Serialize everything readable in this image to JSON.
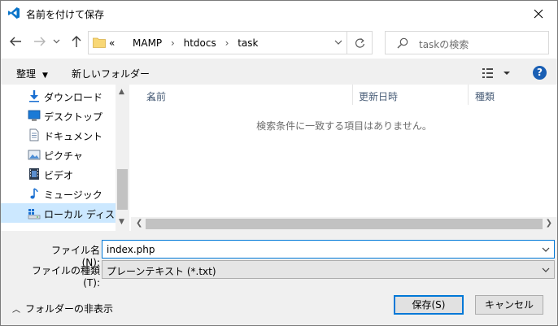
{
  "window": {
    "title": "名前を付けて保存",
    "accent": "#0078d7"
  },
  "nav": {
    "breadcrumbs": [
      "«",
      "MAMP",
      "htdocs",
      "task"
    ],
    "search_placeholder": "taskの検索"
  },
  "toolbar": {
    "organize_label": "整理",
    "new_folder_label": "新しいフォルダー"
  },
  "sidebar": {
    "items": [
      {
        "label": "ダウンロード",
        "icon": "download-icon"
      },
      {
        "label": "デスクトップ",
        "icon": "desktop-icon"
      },
      {
        "label": "ドキュメント",
        "icon": "document-icon"
      },
      {
        "label": "ピクチャ",
        "icon": "picture-icon"
      },
      {
        "label": "ビデオ",
        "icon": "video-icon"
      },
      {
        "label": "ミュージック",
        "icon": "music-icon"
      },
      {
        "label": "ローカル ディスク (C",
        "icon": "drive-icon",
        "selected": true
      }
    ]
  },
  "filelist": {
    "columns": [
      "名前",
      "更新日時",
      "種類"
    ],
    "empty_message": "検索条件に一致する項目はありません。"
  },
  "form": {
    "filename_label": "ファイル名(N):",
    "filename_value": "index.php",
    "filetype_label": "ファイルの種類(T):",
    "filetype_value": "プレーンテキスト (*.txt)"
  },
  "footer": {
    "hide_folders_label": "フォルダーの非表示",
    "save_label": "保存(S)",
    "cancel_label": "キャンセル"
  }
}
